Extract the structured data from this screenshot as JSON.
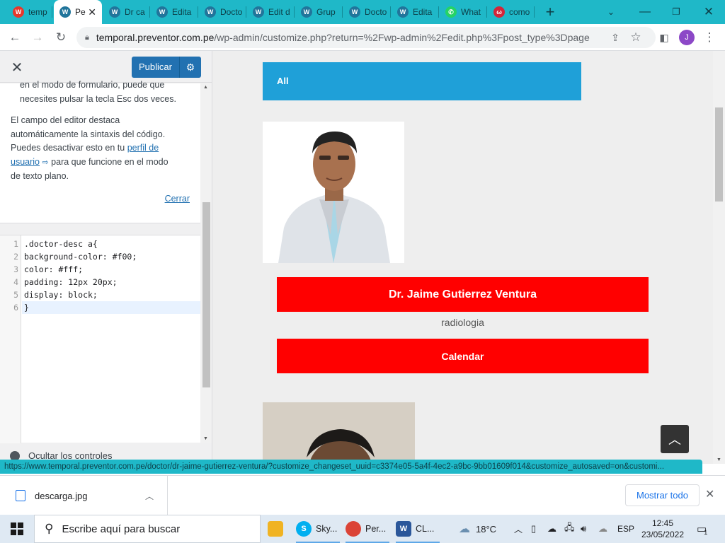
{
  "browser": {
    "tabs": [
      {
        "label": "temp",
        "favicon": "wp-multi-icon",
        "color": "#e6372c"
      },
      {
        "label": "Pe",
        "favicon": "wordpress-icon",
        "color": "#21759b",
        "active": true
      },
      {
        "label": "Dr ca",
        "favicon": "wordpress-icon",
        "color": "#21759b"
      },
      {
        "label": "Edita",
        "favicon": "wordpress-icon",
        "color": "#21759b"
      },
      {
        "label": "Docto",
        "favicon": "wordpress-icon",
        "color": "#21759b"
      },
      {
        "label": "Edit d",
        "favicon": "wordpress-icon",
        "color": "#21759b"
      },
      {
        "label": "Grup",
        "favicon": "wordpress-icon",
        "color": "#21759b"
      },
      {
        "label": "Docto",
        "favicon": "wordpress-icon",
        "color": "#21759b"
      },
      {
        "label": "Edita",
        "favicon": "wordpress-icon",
        "color": "#21759b"
      },
      {
        "label": "What",
        "favicon": "whatsapp-icon",
        "color": "#25d366"
      },
      {
        "label": "como",
        "favicon": "search-engine-icon",
        "color": "#d3263a"
      }
    ],
    "new_tab": "+",
    "url_host": "temporal.preventor.com.pe",
    "url_path": "/wp-admin/customize.php?return=%2Fwp-admin%2Fedit.php%3Fpost_type%3Dpage",
    "profile_initial": "J",
    "status_url": "https://www.temporal.preventor.com.pe/doctor/dr-jaime-gutierrez-ventura/?customize_changeset_uuid=c3374e05-5a4f-4ec2-a9bc-9bb01609f014&customize_autosaved=on&customi..."
  },
  "customizer": {
    "publish_label": "Publicar",
    "help": {
      "line_top_1": "en el modo de formulario, puede que",
      "line_top_2": "necesites pulsar la tecla Esc dos veces.",
      "line_1": "El campo del editor destaca",
      "line_2": "automáticamente la sintaxis del código.",
      "line_3_pre": "Puedes desactivar esto en tu ",
      "link_1": "perfil de",
      "link_2": "usuario",
      "line_4_post": " para que funcione en el modo",
      "line_5": "de texto plano.",
      "close_link": "Cerrar"
    },
    "code_lines": [
      ".doctor-desc a{",
      "background-color: #f00;",
      "color: #fff;",
      "padding: 12px 20px;",
      "display: block;",
      "}"
    ],
    "line_numbers": [
      "1",
      "2",
      "3",
      "4",
      "5",
      "6"
    ],
    "hide_controls": "Ocultar los controles"
  },
  "preview": {
    "filter_label": "All",
    "doctor_name": "Dr. Jaime Gutierrez Ventura",
    "specialty": "radiologia",
    "calendar_label": "Calendar"
  },
  "download_shelf": {
    "file_name": "descarga.jpg",
    "show_all": "Mostrar todo"
  },
  "taskbar": {
    "search_placeholder": "Escribe aquí para buscar",
    "apps": [
      {
        "label": "",
        "icon": "file-explorer-icon",
        "color": "#f0b323"
      },
      {
        "label": "Sky...",
        "icon": "skype-icon",
        "color": "#00aff0"
      },
      {
        "label": "Per...",
        "icon": "chrome-icon",
        "color": "#db4437"
      },
      {
        "label": "CL...",
        "icon": "word-icon",
        "color": "#2b579a"
      }
    ],
    "weather": "18°C",
    "language": "ESP",
    "time": "12:45",
    "date": "23/05/2022",
    "notification_count": "1"
  }
}
